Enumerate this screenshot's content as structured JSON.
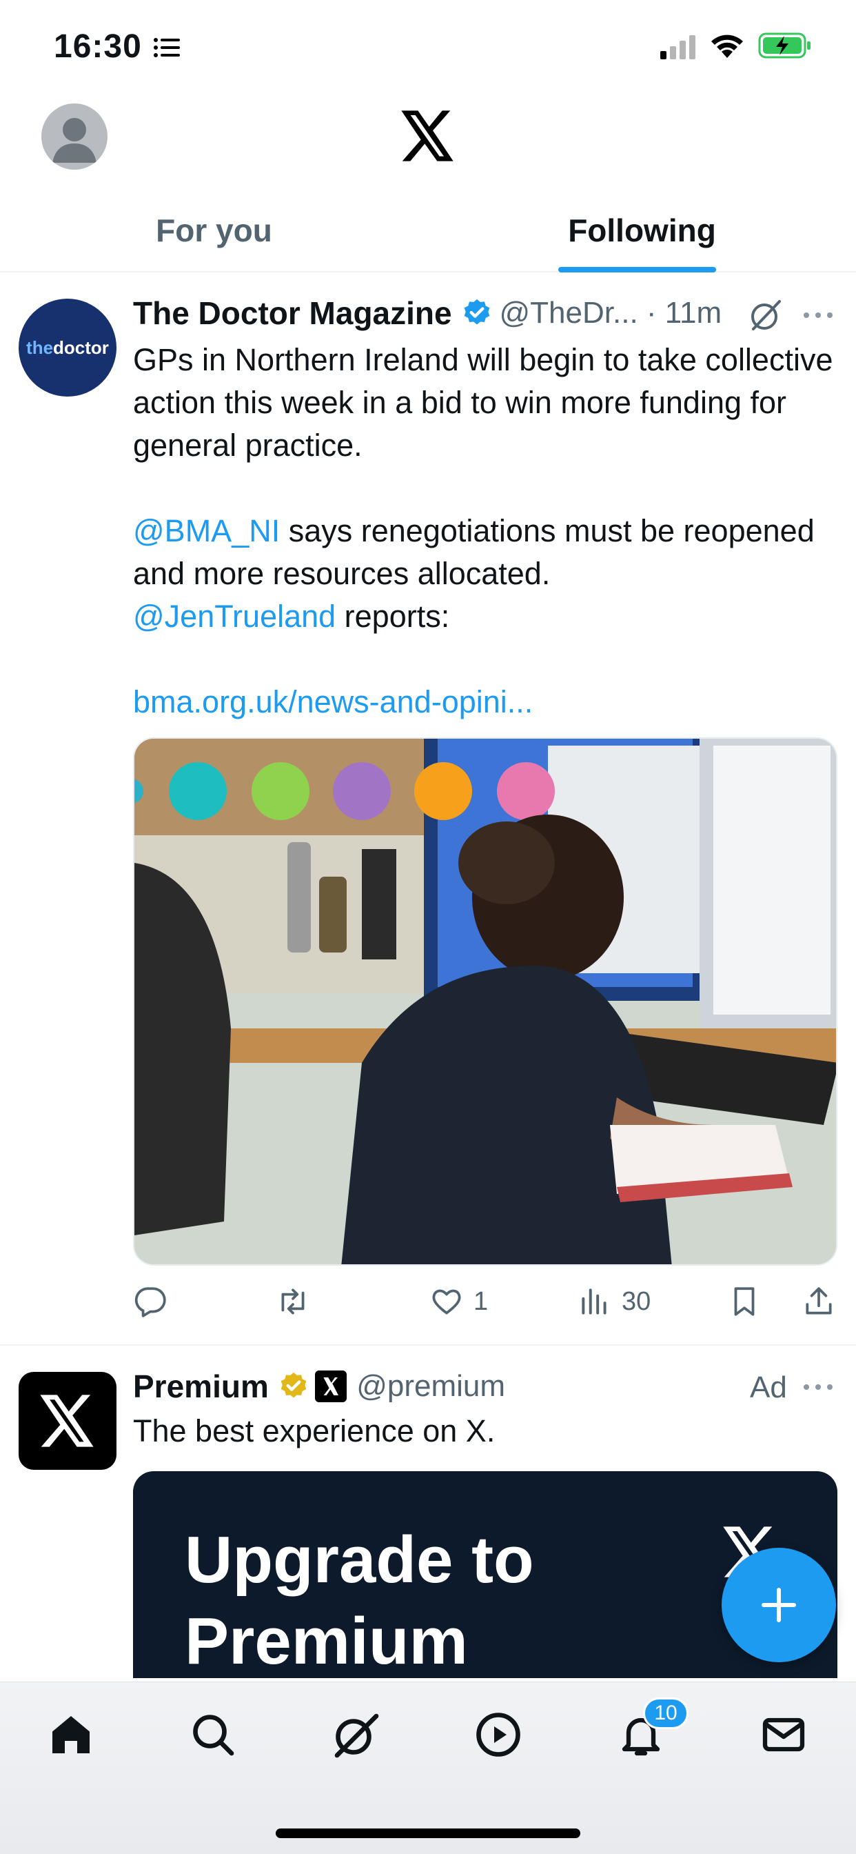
{
  "status_bar": {
    "time": "16:30"
  },
  "tabs": [
    {
      "label": "For you",
      "active": false
    },
    {
      "label": "Following",
      "active": true
    }
  ],
  "tweet": {
    "avatar_text_1": "the",
    "avatar_text_2": "doctor",
    "author_name": "The Doctor Magazine",
    "handle_time": "@TheDr... · 11m",
    "text_line1": "GPs in Northern Ireland will begin to take collective action this week in a bid to win more funding for general practice.",
    "mention1": "@BMA_NI",
    "text_line2": " says renegotiations must be reopened and more resources allocated.",
    "mention2": "@JenTrueland",
    "text_line3": " reports:",
    "link": "bma.org.uk/news-and-opini...",
    "media_alt_icon": "photo",
    "likes": "1",
    "views": "30"
  },
  "ad": {
    "author_name": "Premium",
    "handle": "@premium",
    "ad_label": "Ad",
    "text": "The best experience on X.",
    "card_title": "Upgrade to Premium"
  },
  "nav": {
    "notifications_badge": "10"
  },
  "colors": {
    "accent": "#1d9bf0",
    "text_primary": "#0f1419",
    "text_secondary": "#536471"
  }
}
